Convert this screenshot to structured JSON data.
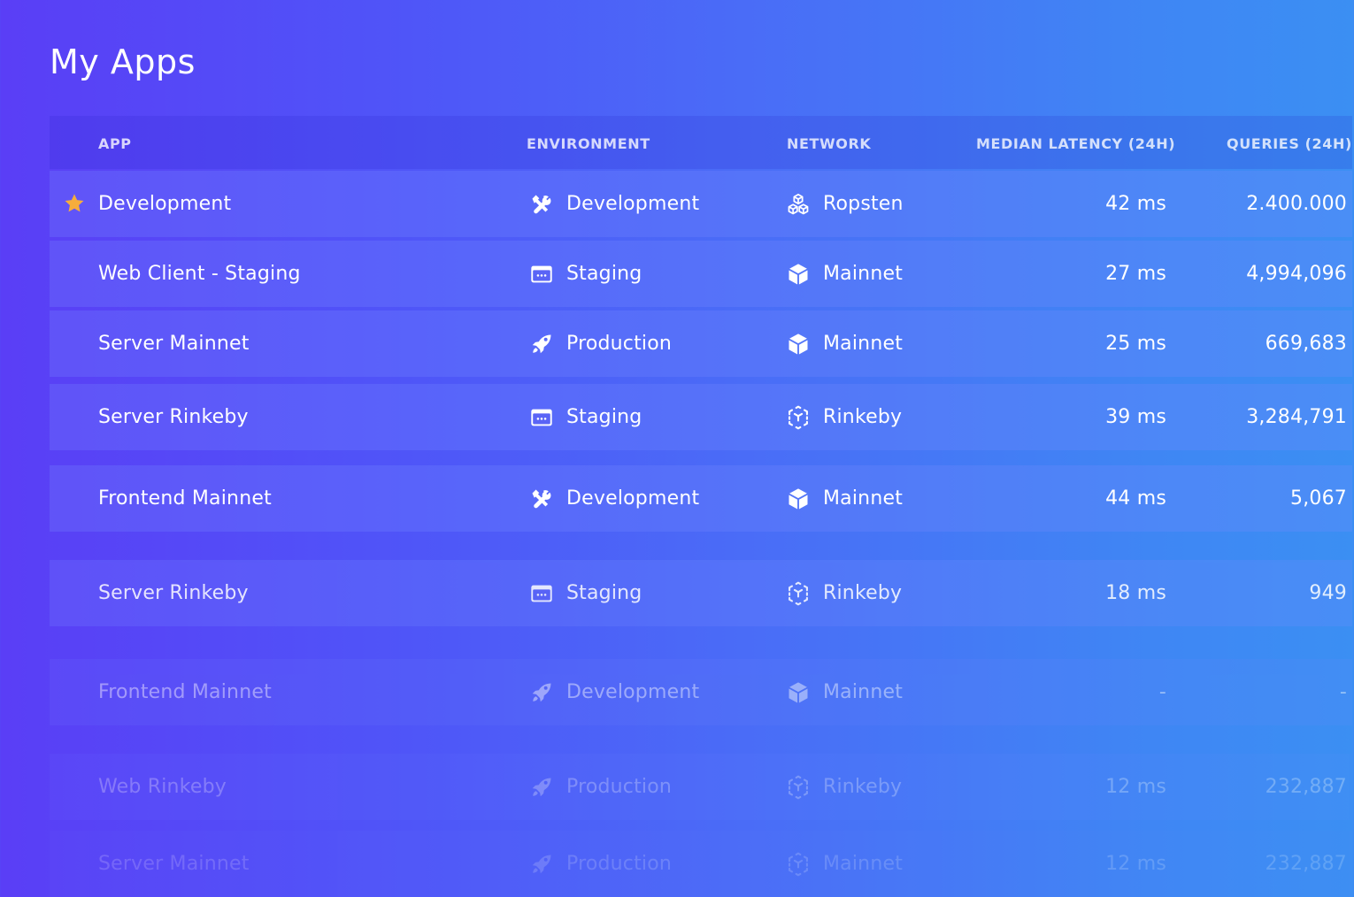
{
  "page": {
    "title": "My Apps"
  },
  "colors": {
    "star": "#f6ad3c",
    "text": "#ffffff"
  },
  "columns": {
    "app": "APP",
    "environment": "ENVIRONMENT",
    "network": "NETWORK",
    "latency": "MEDIAN LATENCY (24H)",
    "queries": "QUERIES (24H)"
  },
  "rows": [
    {
      "app": "Development",
      "starred": true,
      "environment": "Development",
      "env_icon": "tools-icon",
      "network": "Ropsten",
      "net_icon": "cubes-outline-icon",
      "latency": "42 ms",
      "queries": "2.400.000",
      "opacity": 1.0
    },
    {
      "app": "Web Client - Staging",
      "starred": false,
      "environment": "Staging",
      "env_icon": "browser-window-icon",
      "network": "Mainnet",
      "net_icon": "cube-icon",
      "latency": "27 ms",
      "queries": "4,994,096",
      "opacity": 1.0
    },
    {
      "app": "Server Mainnet",
      "starred": false,
      "environment": "Production",
      "env_icon": "rocket-icon",
      "network": "Mainnet",
      "net_icon": "cube-icon",
      "latency": "25 ms",
      "queries": "669,683",
      "opacity": 1.0
    },
    {
      "app": "Server Rinkeby",
      "starred": false,
      "environment": "Staging",
      "env_icon": "browser-window-icon",
      "network": "Rinkeby",
      "net_icon": "cube-dashed-icon",
      "latency": "39 ms",
      "queries": "3,284,791",
      "opacity": 1.0
    },
    {
      "app": "Frontend Mainnet",
      "starred": false,
      "environment": "Development",
      "env_icon": "tools-icon",
      "network": "Mainnet",
      "net_icon": "cube-icon",
      "latency": "44 ms",
      "queries": "5,067",
      "opacity": 1.0
    },
    {
      "app": "Server Rinkeby",
      "starred": false,
      "environment": "Staging",
      "env_icon": "browser-window-icon",
      "network": "Rinkeby",
      "net_icon": "cube-dashed-icon",
      "latency": "18 ms",
      "queries": "949",
      "opacity": 0.85
    },
    {
      "app": "Frontend Mainnet",
      "starred": false,
      "environment": "Development",
      "env_icon": "rocket-icon",
      "network": "Mainnet",
      "net_icon": "cube-icon",
      "latency": "-",
      "queries": "-",
      "opacity": 0.45
    },
    {
      "app": "Web Rinkeby",
      "starred": false,
      "environment": "Production",
      "env_icon": "rocket-icon",
      "network": "Rinkeby",
      "net_icon": "cube-dashed-icon",
      "latency": "12 ms",
      "queries": "232,887",
      "opacity": 0.28
    },
    {
      "app": "Server Mainnet",
      "starred": false,
      "environment": "Production",
      "env_icon": "rocket-icon",
      "network": "Mainnet",
      "net_icon": "cube-dashed-icon",
      "latency": "12 ms",
      "queries": "232,887",
      "opacity": 0.18
    }
  ]
}
